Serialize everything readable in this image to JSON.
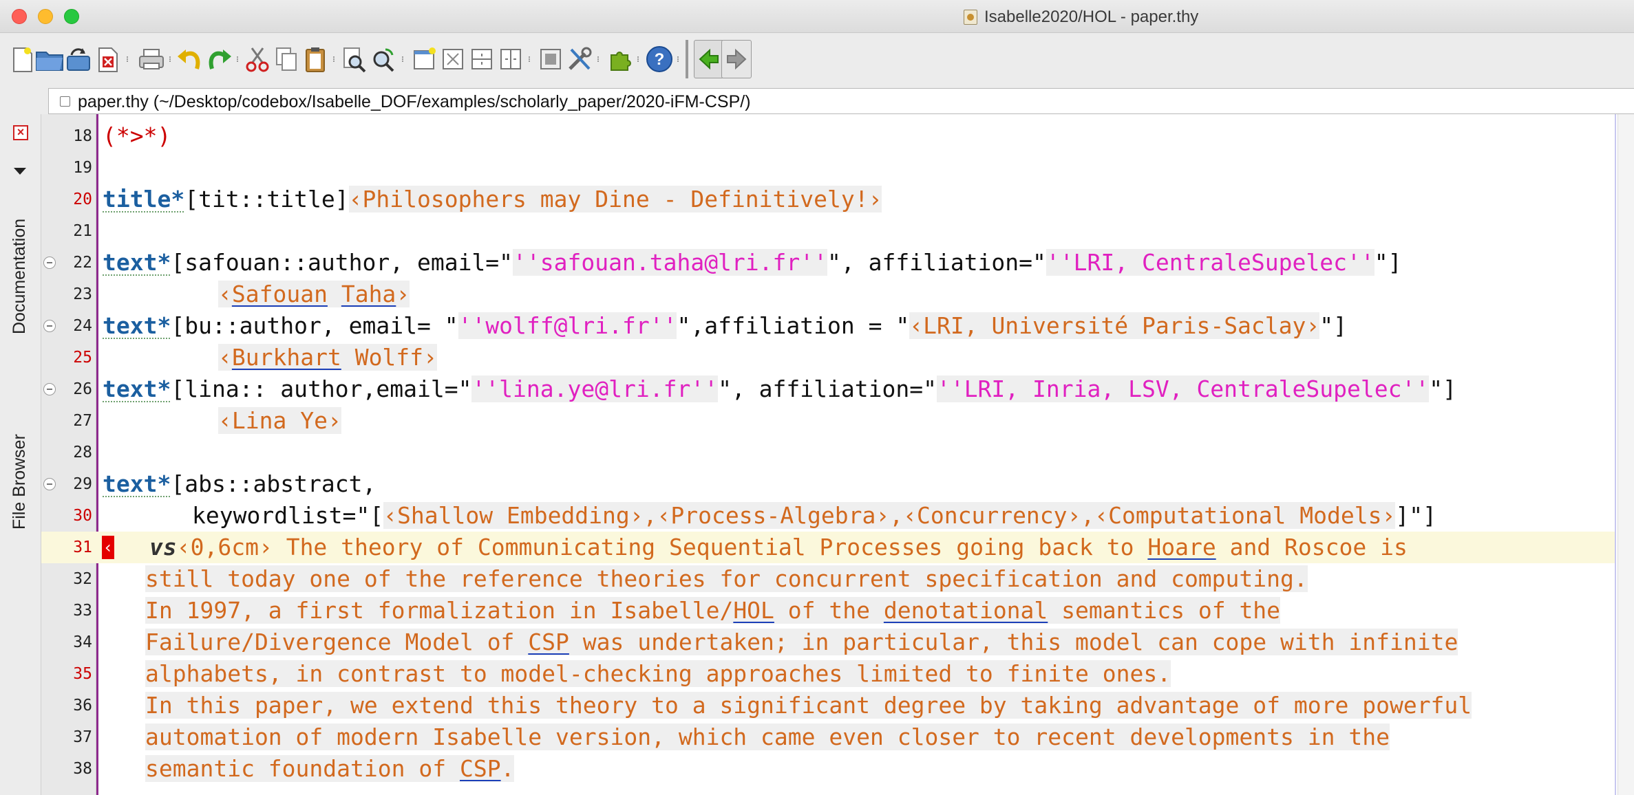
{
  "window": {
    "title": "Isabelle2020/HOL - paper.thy"
  },
  "toolbar": {
    "buttons": [
      "new-file",
      "open-folder",
      "reload",
      "close-buffer",
      "print",
      "undo",
      "redo",
      "cut",
      "copy",
      "paste",
      "find",
      "find-replace",
      "new-view",
      "unsplit",
      "split-horizontal",
      "split-vertical",
      "buffer-options",
      "global-options",
      "plugin-manager",
      "help",
      "navigate-back",
      "navigate-forward"
    ]
  },
  "path": {
    "text": "paper.thy (~/Desktop/codebox/Isabelle_DOF/examples/scholarly_paper/2020-iFM-CSP/)"
  },
  "dock": {
    "tabs": [
      "Documentation",
      "File Browser"
    ]
  },
  "editor": {
    "lines": [
      {
        "num": "18",
        "t1": "(*>*)"
      },
      {
        "num": "19"
      },
      {
        "num": "20",
        "kw": "title*",
        "t1": "[tit::title]",
        "t2": "‹Philosophers may Dine - Definitively!›"
      },
      {
        "num": "21"
      },
      {
        "num": "22",
        "kw": "text*",
        "t1": "[safouan::author, email=\"",
        "t2": "''safouan.taha@lri.fr''",
        "t3": "\", affiliation=\"",
        "t4": "''LRI, CentraleSupelec''",
        "t5": "\"]"
      },
      {
        "num": "23",
        "t1": "‹",
        "t2": "Safouan",
        "t3": " ",
        "t4": "Taha",
        "t5": "›"
      },
      {
        "num": "24",
        "kw": "text*",
        "t1": "[bu::author, email= \"",
        "t2": "''wolff@lri.fr''",
        "t3": "\",affiliation = \"",
        "t4": "‹LRI, Université Paris-Saclay›",
        "t5": "\"]"
      },
      {
        "num": "25",
        "t1": "‹",
        "t2": "Burkhart",
        "t3": " Wolff›"
      },
      {
        "num": "26",
        "kw": "text*",
        "t1": "[lina:: author,email=\"",
        "t2": "''lina.ye@lri.fr''",
        "t3": "\", affiliation=\"",
        "t4": "''LRI, Inria, LSV, CentraleSupelec''",
        "t5": "\"]"
      },
      {
        "num": "27",
        "t1": "‹Lina Ye›"
      },
      {
        "num": "28"
      },
      {
        "num": "29",
        "kw": "text*",
        "t1": "[abs::abstract,"
      },
      {
        "num": "30",
        "t1": "keywordlist=\"[",
        "t2": "‹Shallow Embedding›,‹Process-Algebra›,‹Concurrency›,‹Computational Models›",
        "t3": "]\"]"
      },
      {
        "num": "31",
        "marker": "‹",
        "vs": "vs",
        "t1": "‹0,6cm›",
        "t2": " The theory of Communicating Sequential Processes going back to ",
        "t3": "Hoare",
        "t4": " and Roscoe is"
      },
      {
        "num": "32",
        "t1": "still today one of the reference theories for concurrent specification and computing."
      },
      {
        "num": "33",
        "t1": "In 1997, a first formalization in Isabelle/",
        "t2": "HOL",
        "t3": " of the ",
        "t4": "denotational",
        "t5": " semantics of the"
      },
      {
        "num": "34",
        "t1": "Failure/Divergence Model of ",
        "t2": "CSP",
        "t3": " was undertaken; in particular, this model can cope with infinite"
      },
      {
        "num": "35",
        "t1": "alphabets, in contrast to model-checking approaches limited to finite ones."
      },
      {
        "num": "36",
        "t1": "In this paper, we extend this theory to a significant degree by taking advantage of more powerful"
      },
      {
        "num": "37",
        "t1": "automation of modern Isabelle version, which came even closer to recent developments in the"
      },
      {
        "num": "38",
        "t1": "semantic foundation of ",
        "t2": "CSP",
        "t3": "."
      }
    ]
  }
}
